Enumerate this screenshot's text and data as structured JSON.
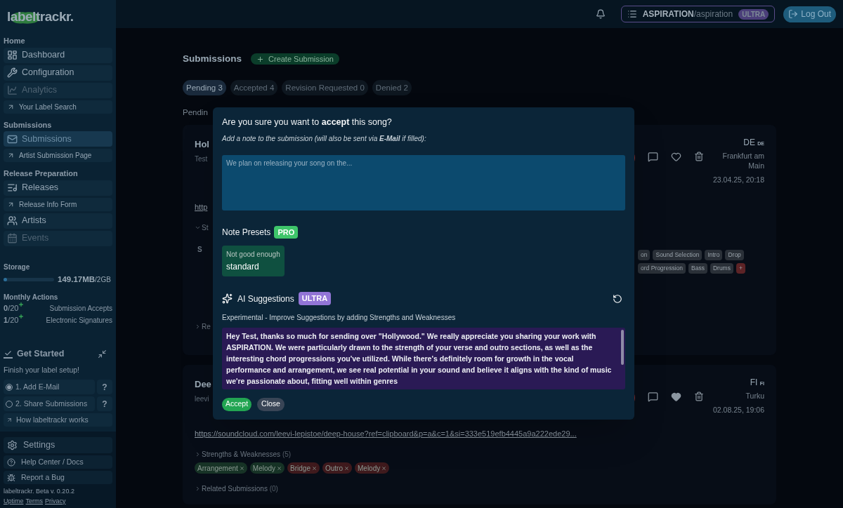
{
  "sidebar": {
    "logo": "labeltrackr.",
    "sections": [
      {
        "title": "Home",
        "items": [
          {
            "label": "Dashboard",
            "kind": "nav",
            "selected": false,
            "disabled": false
          },
          {
            "label": "Configuration",
            "kind": "nav",
            "selected": false,
            "disabled": false
          },
          {
            "label": "Analytics",
            "kind": "nav",
            "selected": false,
            "disabled": true
          },
          {
            "label": "Your Label Search",
            "kind": "link",
            "selected": false,
            "disabled": false
          }
        ]
      },
      {
        "title": "Submissions",
        "items": [
          {
            "label": "Submissions",
            "kind": "nav",
            "selected": true,
            "disabled": false
          },
          {
            "label": "Artist Submission Page",
            "kind": "link",
            "selected": false,
            "disabled": false
          }
        ]
      },
      {
        "title": "Release Preparation",
        "items": [
          {
            "label": "Releases",
            "kind": "nav",
            "selected": false,
            "disabled": false
          },
          {
            "label": "Release Info Form",
            "kind": "link",
            "selected": false,
            "disabled": false
          },
          {
            "label": "Artists",
            "kind": "nav",
            "selected": false,
            "disabled": false
          },
          {
            "label": "Events",
            "kind": "nav",
            "selected": false,
            "disabled": true
          }
        ]
      }
    ],
    "storage": {
      "label": "Storage",
      "level": 0.07,
      "used": "149.17MB",
      "total": "/2GB"
    },
    "monthly_actions": {
      "title": "Monthly Actions",
      "rows": [
        {
          "used": "0",
          "limit": "/20",
          "label": "Submission Accepts"
        },
        {
          "used": "1",
          "limit": "/20",
          "label": "Electronic Signatures"
        }
      ]
    },
    "get_started": {
      "title": "Get Started",
      "subtitle": "Finish your label setup!",
      "steps": [
        {
          "label": "1. Add E-Mail",
          "done": true,
          "help": "?"
        },
        {
          "label": "2. Share Submissions",
          "done": false,
          "help": "?"
        }
      ],
      "link": "How labeltrackr works"
    },
    "bottom_items": [
      "Settings",
      "Help Center / Docs",
      "Report a Bug"
    ],
    "version": "labeltrackr. Beta v. 0.20.2",
    "footer_links": [
      "Uptime",
      "Terms",
      "Privacy"
    ]
  },
  "header": {
    "org_name": "ASPIRATION",
    "org_handle": "/aspiration",
    "plan": "ULTRA",
    "logout": "Log Out"
  },
  "page": {
    "title": "Submissions",
    "create": "Create Submission",
    "tabs": [
      {
        "label": "Pending 3",
        "selected": true
      },
      {
        "label": "Accepted 4",
        "selected": false
      },
      {
        "label": "Revision Requested 0",
        "selected": false
      },
      {
        "label": "Denied 2",
        "selected": false
      }
    ],
    "list_label": "Pendin"
  },
  "submissions": [
    {
      "title": "Hol",
      "subtitle": "Test",
      "country": "DE",
      "country_code": "DE",
      "city": "Frankfurt am Main",
      "date": "23.04.25, 20:18",
      "favorite": false,
      "link": "http",
      "sections": [
        {
          "label": "St",
          "expanded": true,
          "sub_label": "S",
          "chips": [
            {
              "label": "on",
              "color": "#2a3038"
            },
            {
              "label": "Sound Selection",
              "color": "#2a3038"
            },
            {
              "label": "Intro",
              "color": "#2a3038"
            },
            {
              "label": "Drop",
              "color": "#2a3038"
            },
            {
              "label": "ord Progression",
              "color": "#2a3038"
            },
            {
              "label": "Bass",
              "color": "#2a3038"
            },
            {
              "label": "Drums",
              "color": "#2a3038"
            },
            {
              "label": "+",
              "color": "#5c2326"
            }
          ]
        },
        {
          "label": "Re",
          "expanded": false
        }
      ]
    },
    {
      "title": "Dee",
      "subtitle": "leevi",
      "country": "FI",
      "country_code": "FI",
      "city": "Turku",
      "date": "02.08.25, 19:06",
      "favorite": true,
      "link": "https://soundcloud.com/leevi-lepistoe/deep-house?ref=clipboard&p=a&c=1&si=333e519efb4445a9a222ede29...",
      "sections": [
        {
          "label": "Strengths & Weaknesses",
          "count": "(5)",
          "expanded": false,
          "tags": [
            {
              "label": "Arrangement",
              "color": "#173326"
            },
            {
              "label": "Melody",
              "color": "#173326"
            },
            {
              "label": "Bridge",
              "color": "#3f1a1d"
            },
            {
              "label": "Outro",
              "color": "#3f1a1d"
            },
            {
              "label": "Melody",
              "color": "#3f1a1d"
            }
          ]
        },
        {
          "label": "Related Submissions",
          "count": "(0)",
          "expanded": false
        }
      ]
    }
  ],
  "modal": {
    "question": "Are you sure you want to **accept** this song?",
    "note_hint": "Add a note to the submission (will also be sent via **E-Mail** if filled):",
    "note_placeholder": "We plan on releasing your song on the...",
    "presets_title": "Note Presets",
    "presets_badge": "PRO",
    "presets": [
      {
        "title": "Not good enough",
        "type": "standard"
      }
    ],
    "ai_title": "AI Suggestions",
    "ai_badge": "ULTRA",
    "ai_hint": "Experimental - Improve Suggestions by adding Strengths and Weaknesses",
    "ai_text": "Hey Test, thanks so much for sending over \"Hollywood.\" We really appreciate you sharing your work with ASPIRATION. We were particularly drawn to the strength of your verse and outro sections, as well as the interesting chord progressions you've utilized. While there's definitely room for growth in the vocal performance and arrangement, we see real potential in your sound and believe it aligns with the kind of music we're passionate about, fitting well within genres",
    "accept": "Accept",
    "close": "Close"
  }
}
